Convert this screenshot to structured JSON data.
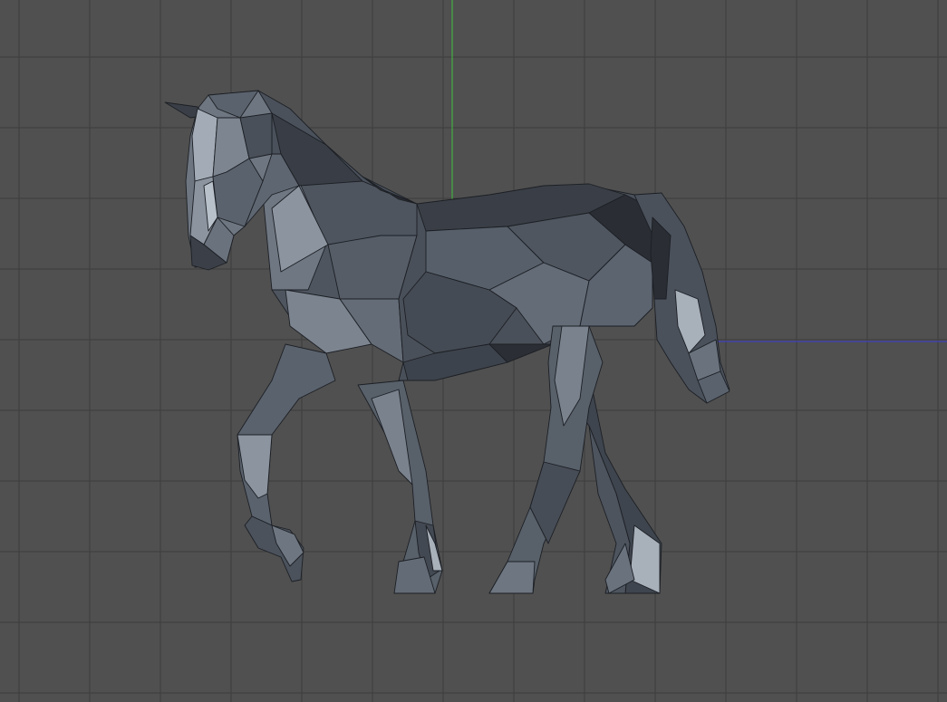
{
  "viewport": {
    "name": "3D Viewport",
    "background_color": "#505050",
    "grid_color": "#3d3d3d",
    "grid_visible": true,
    "y_axis_color": "#3fbf3f",
    "x_axis_color": "#3b3bd6"
  },
  "model": {
    "name": "low-poly-horse",
    "shading": "flat",
    "wireframe_overlay": true,
    "base_color": "#5a616b",
    "edge_color": "#1c1f24"
  }
}
